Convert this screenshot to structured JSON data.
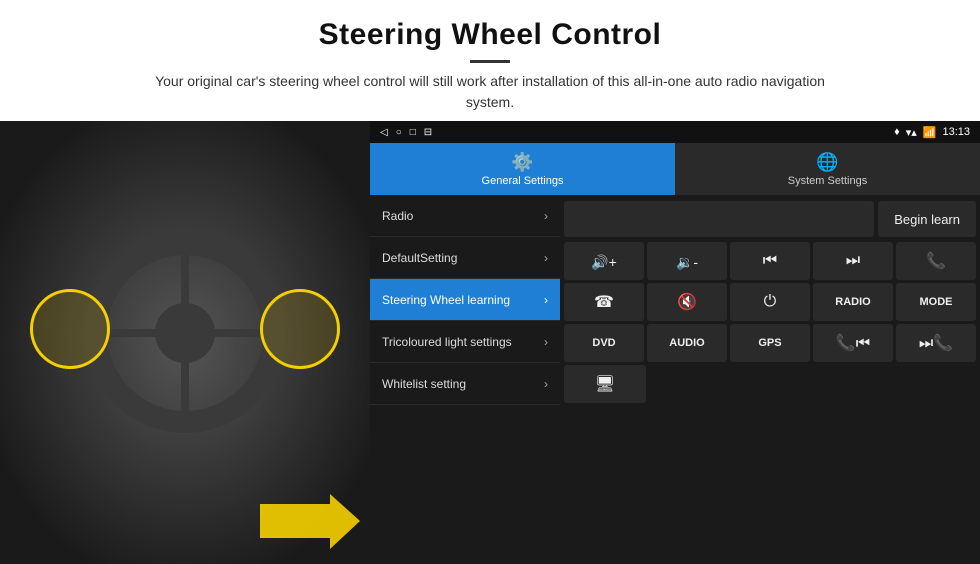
{
  "header": {
    "title": "Steering Wheel Control",
    "description": "Your original car's steering wheel control will still work after installation of this all-in-one auto radio navigation system."
  },
  "status_bar": {
    "nav_back": "◁",
    "nav_home": "○",
    "nav_square": "□",
    "nav_menu": "⊟",
    "signal_icon": "▾",
    "wifi_icon": "▾",
    "time": "13:13"
  },
  "tabs": [
    {
      "id": "general",
      "label": "General Settings",
      "icon": "⚙",
      "active": true
    },
    {
      "id": "system",
      "label": "System Settings",
      "icon": "🌐",
      "active": false
    }
  ],
  "menu_items": [
    {
      "id": "radio",
      "label": "Radio",
      "active": false
    },
    {
      "id": "defaultsetting",
      "label": "DefaultSetting",
      "active": false
    },
    {
      "id": "swlearning",
      "label": "Steering Wheel learning",
      "active": true
    },
    {
      "id": "tricoloured",
      "label": "Tricoloured light settings",
      "active": false
    },
    {
      "id": "whitelist",
      "label": "Whitelist setting",
      "active": false
    }
  ],
  "controls": {
    "begin_learn_label": "Begin learn",
    "row1": [
      {
        "icon": "🔊+",
        "label": "vol-up"
      },
      {
        "icon": "🔉-",
        "label": "vol-down"
      },
      {
        "icon": "⏮",
        "label": "prev"
      },
      {
        "icon": "⏭",
        "label": "next"
      },
      {
        "icon": "📞",
        "label": "call"
      }
    ],
    "row2": [
      {
        "icon": "📞",
        "label": "answer"
      },
      {
        "icon": "🔇",
        "label": "mute"
      },
      {
        "icon": "⏻",
        "label": "power"
      },
      {
        "text": "RADIO",
        "label": "radio"
      },
      {
        "text": "MODE",
        "label": "mode"
      }
    ],
    "row3": [
      {
        "text": "DVD",
        "label": "dvd"
      },
      {
        "text": "AUDIO",
        "label": "audio"
      },
      {
        "text": "GPS",
        "label": "gps"
      },
      {
        "icon": "📞⏮",
        "label": "call-prev"
      },
      {
        "icon": "⏭📞",
        "label": "next-call"
      }
    ],
    "row4": [
      {
        "icon": "🖥",
        "label": "screen"
      }
    ]
  }
}
